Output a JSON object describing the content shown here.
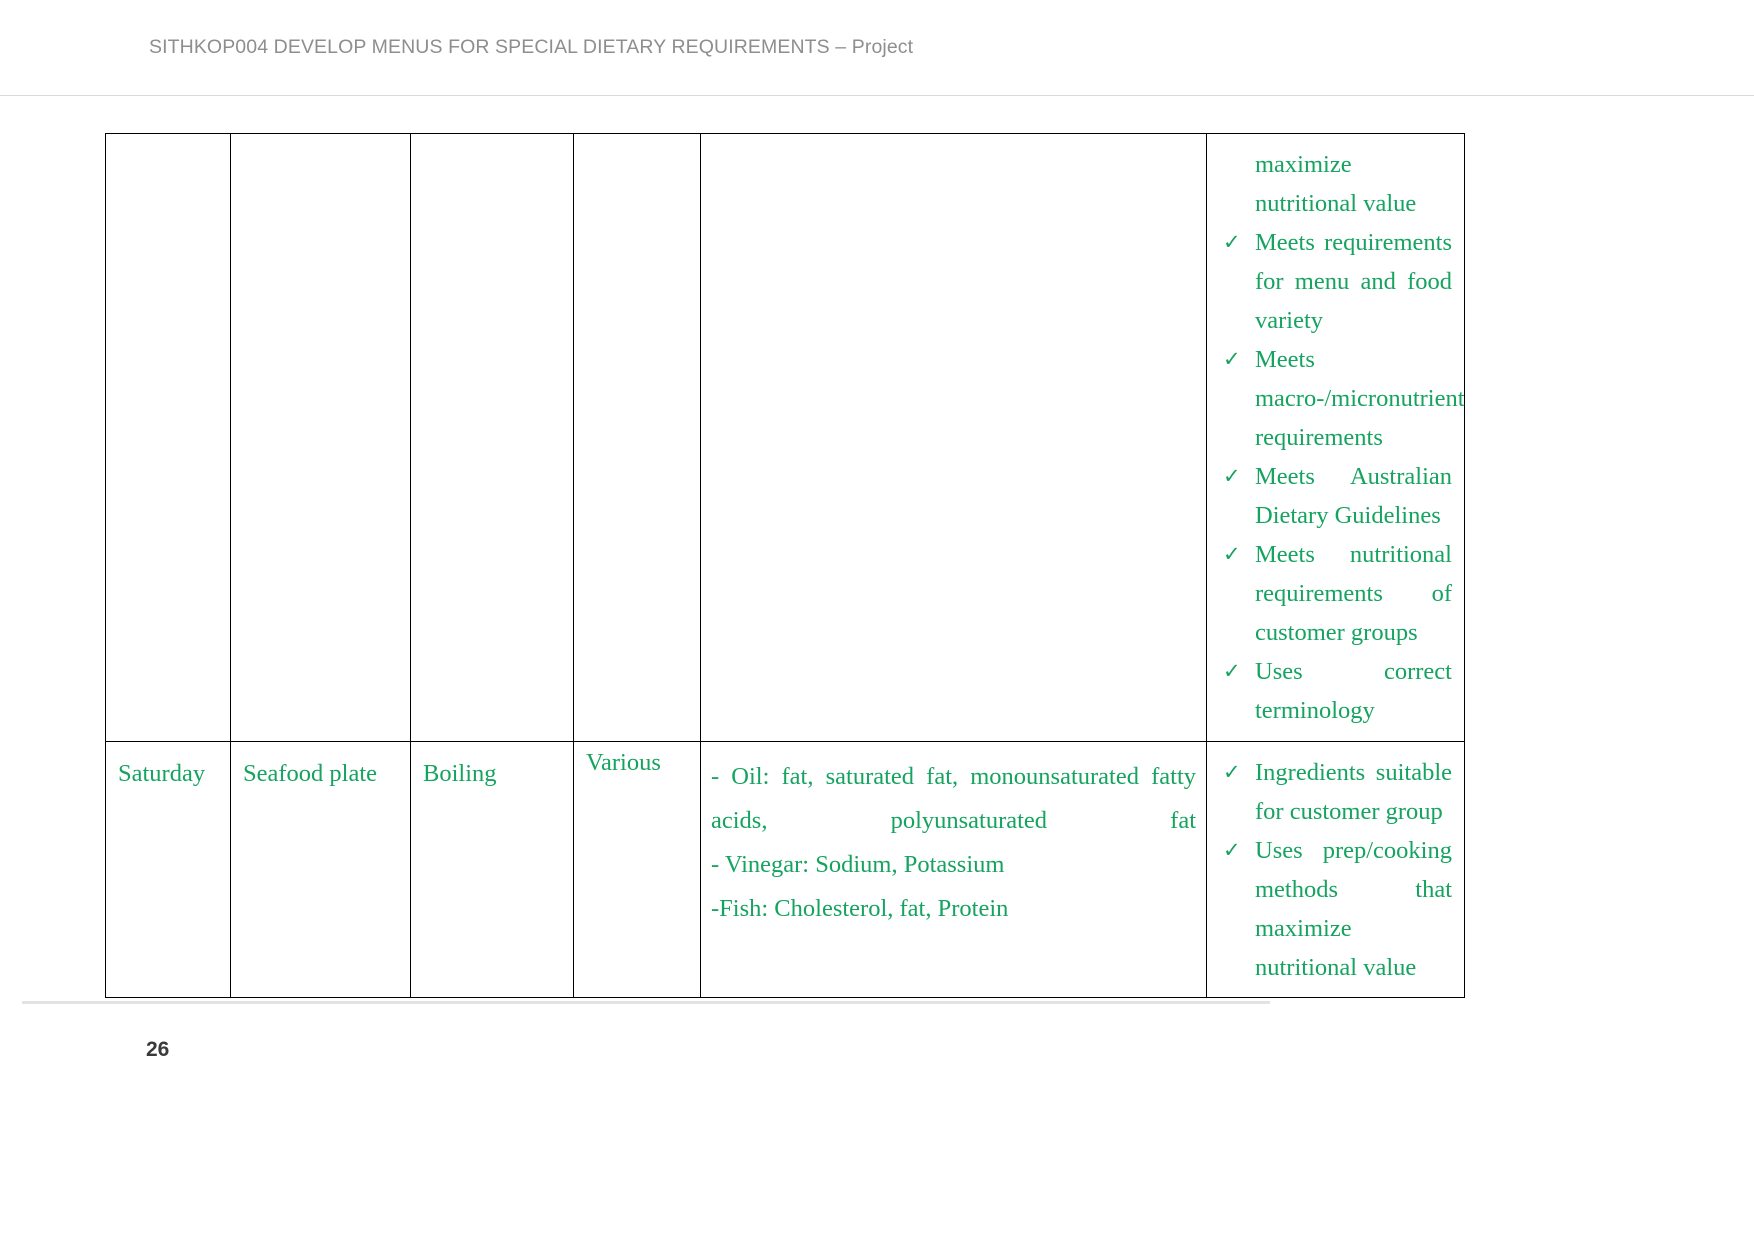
{
  "header": {
    "title": "SITHKOP004 DEVELOP MENUS FOR SPECIAL DIETARY REQUIREMENTS – Project"
  },
  "footer": {
    "page_number": "26"
  },
  "colors": {
    "text_green": "#16a360",
    "header_gray": "#8e8e8e",
    "table_border": "#000000",
    "page_number": "#3b3b3b",
    "rule_gray": "#e3e3e3"
  },
  "icons": {
    "checkmark": "✓"
  },
  "table": {
    "rows": [
      {
        "id": "row-continued",
        "day": "",
        "dish": "",
        "cooking_method": "",
        "various": "",
        "nutrients": [],
        "criteria_continuation": "maximize nutritional value",
        "criteria": [
          "Meets requirements for menu and food variety",
          "Meets macro-/micronutrient requirements",
          "Meets Australian Dietary Guidelines",
          "Meets nutritional requirements of customer groups",
          "Uses correct terminology"
        ]
      },
      {
        "id": "row-saturday",
        "day": "Saturday",
        "dish": "Seafood plate",
        "cooking_method": "Boiling",
        "various": "Various",
        "nutrients": [
          "- Oil: fat, saturated fat, monounsaturated fatty acids, polyunsaturated fat",
          "- Vinegar: Sodium, Potassium",
          "-Fish: Cholesterol, fat, Protein"
        ],
        "criteria_continuation": "",
        "criteria": [
          "Ingredients suitable for customer group",
          "Uses prep/cooking methods that maximize nutritional value"
        ]
      }
    ]
  }
}
